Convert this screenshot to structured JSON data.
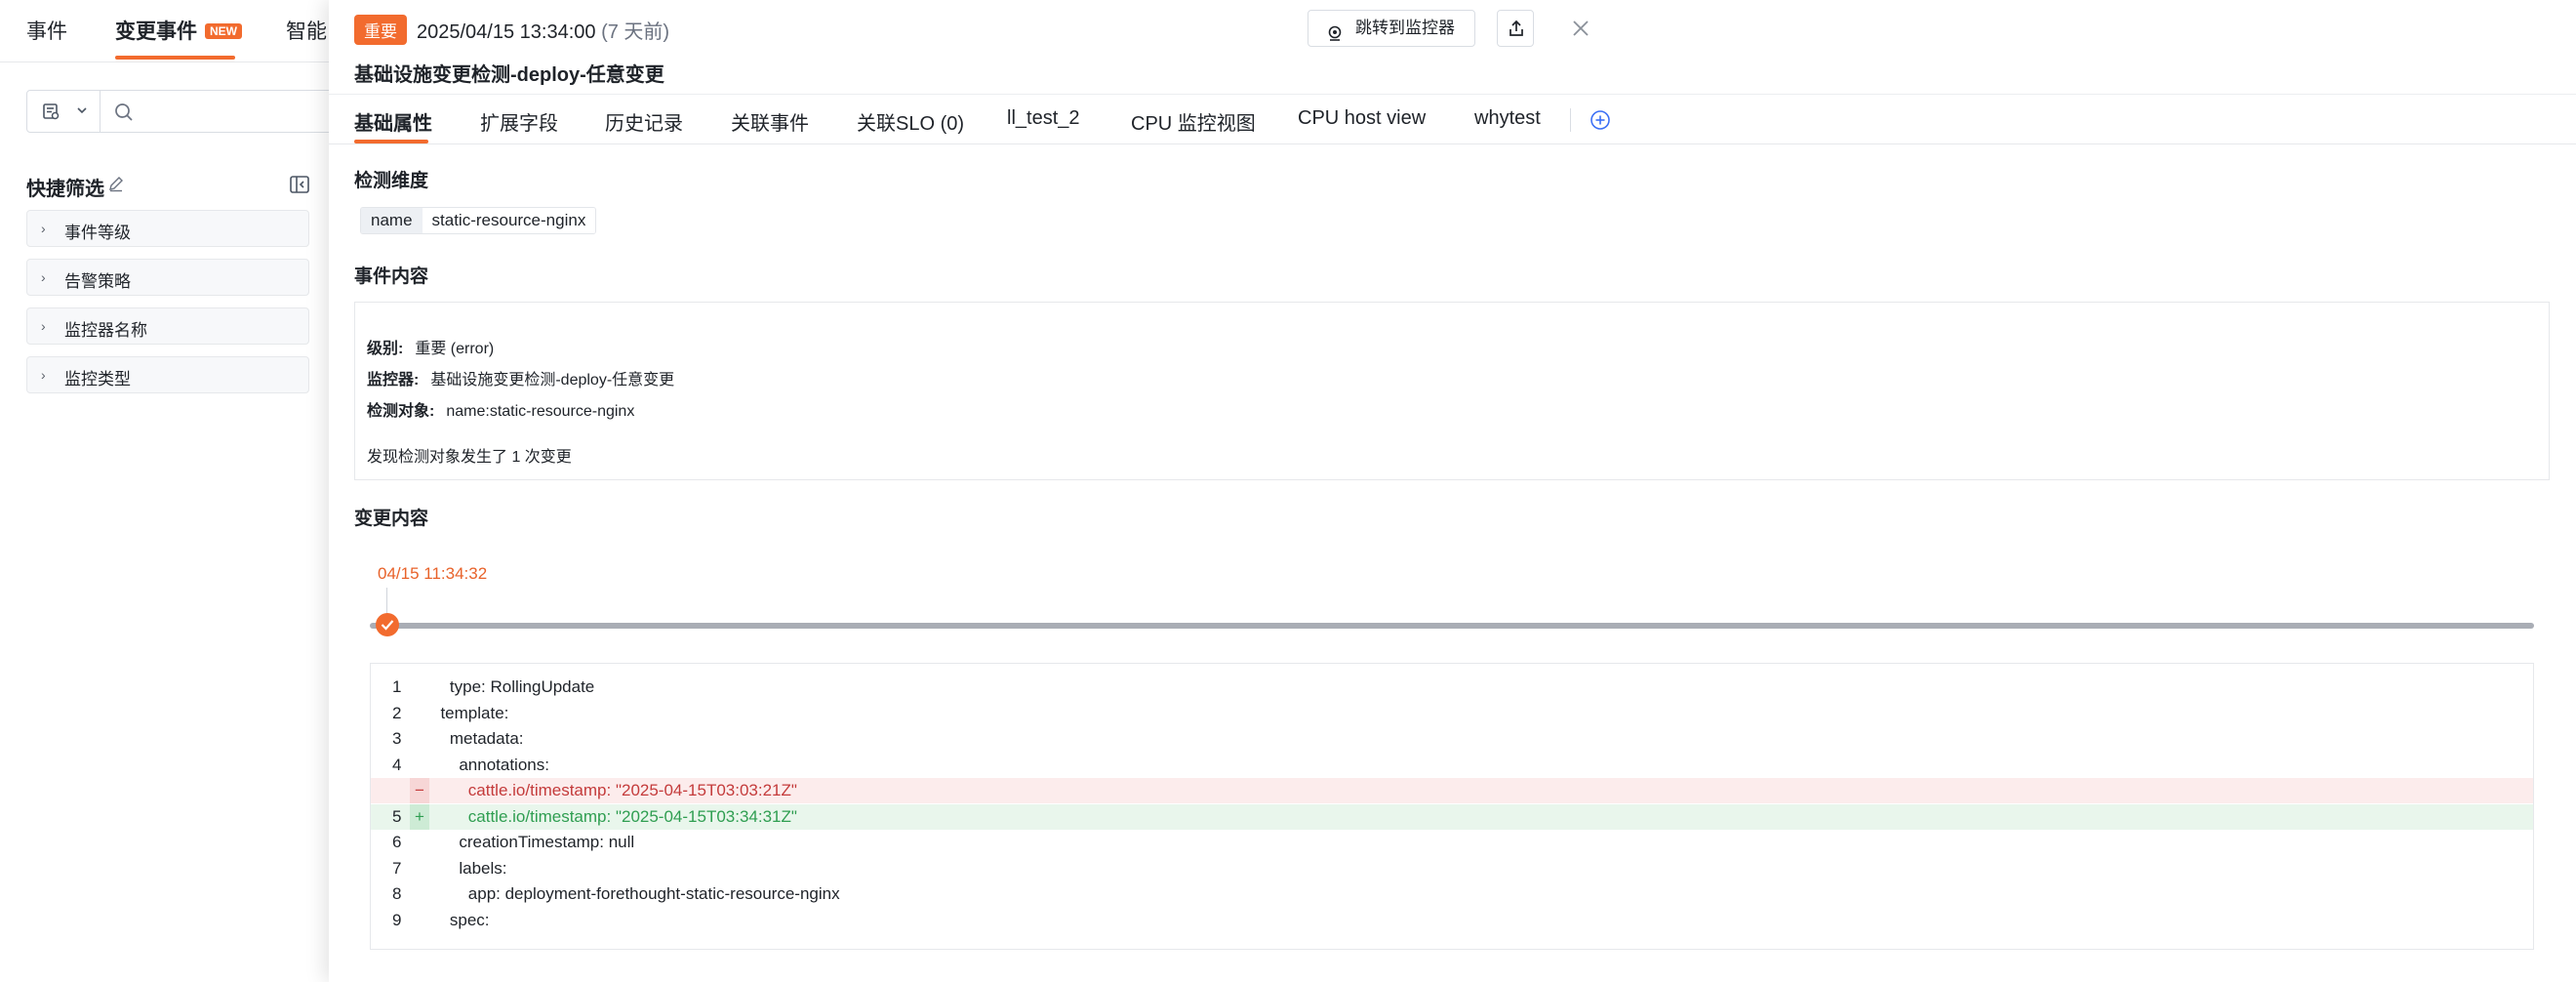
{
  "left": {
    "tabs": [
      "事件",
      "变更事件",
      "智能"
    ],
    "new_badge": "NEW",
    "quick_filter_title": "快捷筛选",
    "filters": [
      "事件等级",
      "告警策略",
      "监控器名称",
      "监控类型"
    ]
  },
  "drawer": {
    "severity": "重要",
    "timestamp": "2025/04/15 13:34:00",
    "ago": "(7 天前)",
    "title": "基础设施变更检测-deploy-任意变更",
    "jump_button": "跳转到监控器",
    "tabs": [
      "基础属性",
      "扩展字段",
      "历史记录",
      "关联事件",
      "关联SLO (0)",
      "ll_test_2",
      "CPU 监控视图",
      "CPU host view",
      "whytest"
    ],
    "detect_dimension_title": "检测维度",
    "dimension": {
      "key": "name",
      "value": "static-resource-nginx"
    },
    "event_content_title": "事件内容",
    "event": {
      "level_label": "级别:",
      "level_value": "重要 (error)",
      "monitor_label": "监控器:",
      "monitor_value": "基础设施变更检测-deploy-任意变更",
      "target_label": "检测对象:",
      "target_value": "name:static-resource-nginx",
      "summary": "发现检测对象发生了 1 次变更"
    },
    "change_content_title": "变更内容",
    "timeline_time": "04/15 11:34:32",
    "diff": [
      {
        "ln": "1",
        "mk": "",
        "type": "ctx",
        "code": "    type: RollingUpdate"
      },
      {
        "ln": "2",
        "mk": "",
        "type": "ctx",
        "code": "  template:"
      },
      {
        "ln": "3",
        "mk": "",
        "type": "ctx",
        "code": "    metadata:"
      },
      {
        "ln": "4",
        "mk": "",
        "type": "ctx",
        "code": "      annotations:"
      },
      {
        "ln": "",
        "mk": "−",
        "type": "del",
        "code": "        cattle.io/timestamp: \"2025-04-15T03:03:21Z\""
      },
      {
        "ln": "5",
        "mk": "+",
        "type": "add",
        "code": "        cattle.io/timestamp: \"2025-04-15T03:34:31Z\""
      },
      {
        "ln": "6",
        "mk": "",
        "type": "ctx",
        "code": "      creationTimestamp: null"
      },
      {
        "ln": "7",
        "mk": "",
        "type": "ctx",
        "code": "      labels:"
      },
      {
        "ln": "8",
        "mk": "",
        "type": "ctx",
        "code": "        app: deployment-forethought-static-resource-nginx"
      },
      {
        "ln": "9",
        "mk": "",
        "type": "ctx",
        "code": "    spec:"
      }
    ]
  },
  "colors": {
    "accent": "#f26b2e",
    "diff_del_bg": "#fcecec",
    "diff_add_bg": "#e9f6ec"
  }
}
